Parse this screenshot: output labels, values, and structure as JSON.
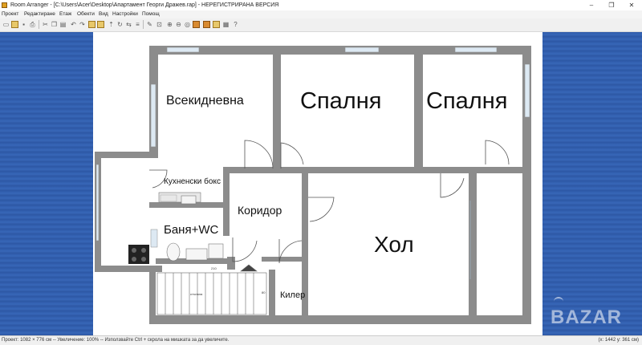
{
  "window": {
    "title": "Room Arranger - [C:\\Users\\Acer\\Desktop\\Апартамент Георги Дражев.rap] - НЕРЕГИСТРИРАНА ВЕРСИЯ",
    "minimize": "–",
    "maximize": "❐",
    "close": "✕"
  },
  "menu": [
    "Проект",
    "Редактиране",
    "Етаж",
    "Обекти",
    "Вид",
    "Настройки",
    "Помощ"
  ],
  "toolbar": {
    "icons": [
      "new-icon",
      "open-icon",
      "save-icon",
      "print-icon",
      "cut-icon",
      "copy-icon",
      "paste-icon",
      "undo-icon",
      "redo-icon",
      "add-object-icon",
      "edit-icon",
      "select-icon",
      "zoom-fit-icon",
      "zoom-in-icon",
      "zoom-out-icon",
      "view-3d-icon",
      "room-icon",
      "layers-icon",
      "floor-icon",
      "help-icon",
      "about-icon"
    ]
  },
  "floorplan": {
    "rooms": [
      {
        "id": "living",
        "label": "Всекидневна"
      },
      {
        "id": "bedroom1",
        "label": "Спалня"
      },
      {
        "id": "bedroom2",
        "label": "Спалня"
      },
      {
        "id": "kitchen",
        "label": "Кухненски бокс"
      },
      {
        "id": "corridor",
        "label": "Коридор"
      },
      {
        "id": "bath",
        "label": "Баня+WC"
      },
      {
        "id": "hall",
        "label": "Хол"
      },
      {
        "id": "pantry",
        "label": "Килер"
      }
    ],
    "stairs_label": "стъпала",
    "dim_label": "210",
    "dim_label_2": "80"
  },
  "status": {
    "left": "Проект: 1082 × 776 см -- Увеличение: 100% -- Използвайте Ctrl + скрола на мишката за да увеличите.",
    "right": "(x: 1442 y: 361 см)"
  },
  "watermark": "BAZAR",
  "colors": {
    "wall": "#8c8c8c",
    "side": "#2f5aa8",
    "window": "#cfe4f4"
  }
}
